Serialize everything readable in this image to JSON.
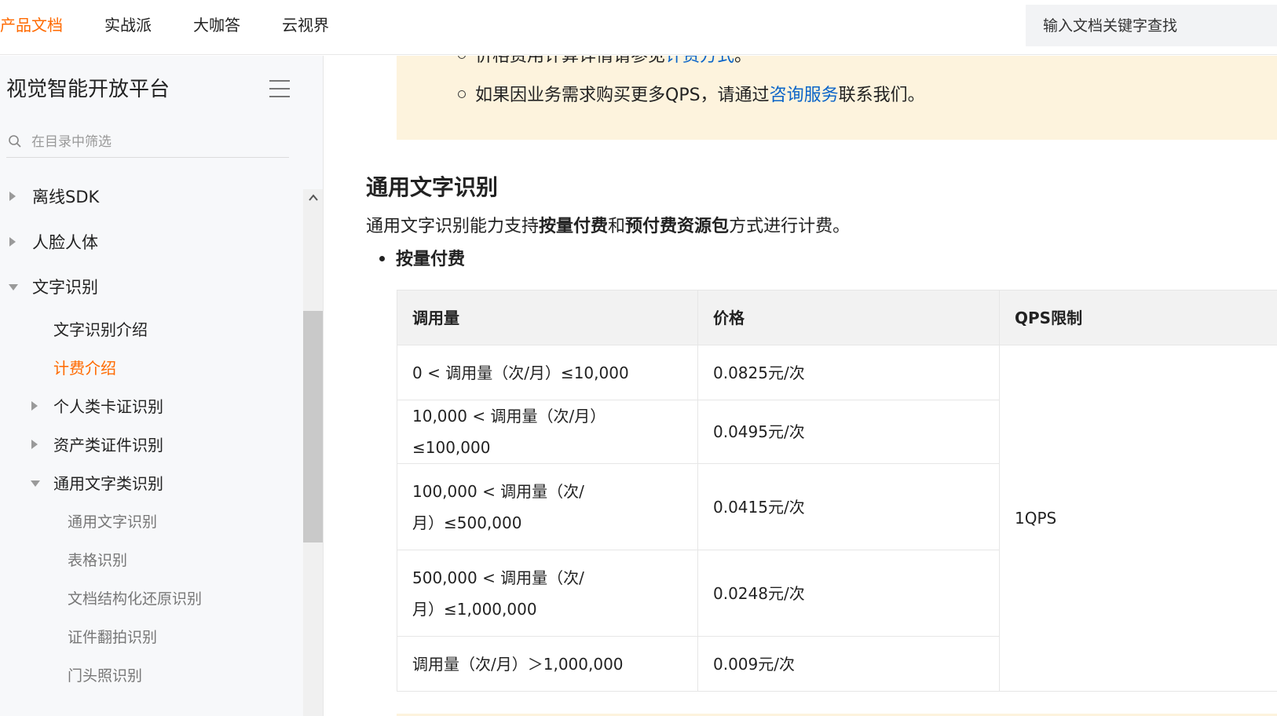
{
  "topnav": {
    "items": [
      {
        "label": "产品文档",
        "active": true
      },
      {
        "label": "实战派",
        "active": false
      },
      {
        "label": "大咖答",
        "active": false
      },
      {
        "label": "云视界",
        "active": false
      }
    ],
    "search_placeholder": "输入文档关键字查找"
  },
  "sidebar": {
    "title": "视觉智能开放平台",
    "filter_placeholder": "在目录中筛选",
    "items": [
      {
        "label": "离线SDK",
        "level": 0,
        "arrow": "right"
      },
      {
        "label": "人脸人体",
        "level": 0,
        "arrow": "right"
      },
      {
        "label": "文字识别",
        "level": 0,
        "arrow": "down"
      },
      {
        "label": "文字识别介绍",
        "level": 1,
        "arrow": ""
      },
      {
        "label": "计费介绍",
        "level": 1,
        "arrow": "",
        "active": true
      },
      {
        "label": "个人类卡证识别",
        "level": 1,
        "arrow": "right"
      },
      {
        "label": "资产类证件识别",
        "level": 1,
        "arrow": "right"
      },
      {
        "label": "通用文字类识别",
        "level": 1,
        "arrow": "down"
      },
      {
        "label": "通用文字识别",
        "level": 2,
        "arrow": ""
      },
      {
        "label": "表格识别",
        "level": 2,
        "arrow": ""
      },
      {
        "label": "文档结构化还原识别",
        "level": 2,
        "arrow": ""
      },
      {
        "label": "证件翻拍识别",
        "level": 2,
        "arrow": ""
      },
      {
        "label": "门头照识别",
        "level": 2,
        "arrow": ""
      }
    ]
  },
  "main": {
    "note": {
      "line1_prefix": "价格费用计算详情请参见",
      "line1_link": "计费方式",
      "line1_suffix": "。",
      "line2_prefix": "如果因业务需求购买更多QPS，请通过",
      "line2_link": "咨询服务",
      "line2_suffix": "联系我们。"
    },
    "section_title": "通用文字识别",
    "desc_prefix": "通用文字识别能力支持",
    "desc_bold1": "按量付费",
    "desc_mid": "和",
    "desc_bold2": "预付费资源包",
    "desc_suffix": "方式进行计费。",
    "bullet": "按量付费",
    "table": {
      "headers": [
        "调用量",
        "价格",
        "QPS限制"
      ],
      "rows": [
        {
          "usage": "0 < 调用量（次/月）≤10,000",
          "price": "0.0825元/次"
        },
        {
          "usage": "10,000 < 调用量（次/月）≤100,000",
          "price": "0.0495元/次"
        },
        {
          "usage": "100,000 < 调用量（次/月）≤500,000",
          "price": "0.0415元/次"
        },
        {
          "usage": "500,000 < 调用量（次/月）≤1,000,000",
          "price": "0.0248元/次"
        },
        {
          "usage": "调用量（次/月）＞1,000,000",
          "price": "0.009元/次"
        }
      ],
      "qps": "1QPS"
    }
  },
  "colors": {
    "accent": "#ff6a00",
    "link": "#0a64c8",
    "note_bg": "#fdf3dd"
  }
}
